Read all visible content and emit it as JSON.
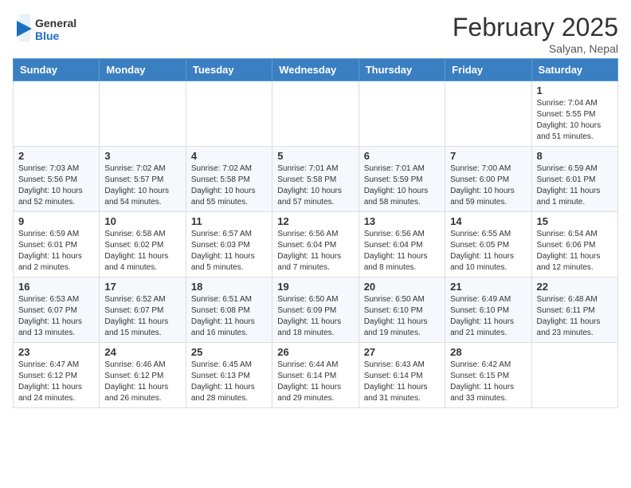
{
  "header": {
    "logo_general": "General",
    "logo_blue": "Blue",
    "month_title": "February 2025",
    "subtitle": "Salyan, Nepal"
  },
  "weekdays": [
    "Sunday",
    "Monday",
    "Tuesday",
    "Wednesday",
    "Thursday",
    "Friday",
    "Saturday"
  ],
  "weeks": [
    [
      {
        "day": "",
        "info": ""
      },
      {
        "day": "",
        "info": ""
      },
      {
        "day": "",
        "info": ""
      },
      {
        "day": "",
        "info": ""
      },
      {
        "day": "",
        "info": ""
      },
      {
        "day": "",
        "info": ""
      },
      {
        "day": "1",
        "info": "Sunrise: 7:04 AM\nSunset: 5:55 PM\nDaylight: 10 hours\nand 51 minutes."
      }
    ],
    [
      {
        "day": "2",
        "info": "Sunrise: 7:03 AM\nSunset: 5:56 PM\nDaylight: 10 hours\nand 52 minutes."
      },
      {
        "day": "3",
        "info": "Sunrise: 7:02 AM\nSunset: 5:57 PM\nDaylight: 10 hours\nand 54 minutes."
      },
      {
        "day": "4",
        "info": "Sunrise: 7:02 AM\nSunset: 5:58 PM\nDaylight: 10 hours\nand 55 minutes."
      },
      {
        "day": "5",
        "info": "Sunrise: 7:01 AM\nSunset: 5:58 PM\nDaylight: 10 hours\nand 57 minutes."
      },
      {
        "day": "6",
        "info": "Sunrise: 7:01 AM\nSunset: 5:59 PM\nDaylight: 10 hours\nand 58 minutes."
      },
      {
        "day": "7",
        "info": "Sunrise: 7:00 AM\nSunset: 6:00 PM\nDaylight: 10 hours\nand 59 minutes."
      },
      {
        "day": "8",
        "info": "Sunrise: 6:59 AM\nSunset: 6:01 PM\nDaylight: 11 hours\nand 1 minute."
      }
    ],
    [
      {
        "day": "9",
        "info": "Sunrise: 6:59 AM\nSunset: 6:01 PM\nDaylight: 11 hours\nand 2 minutes."
      },
      {
        "day": "10",
        "info": "Sunrise: 6:58 AM\nSunset: 6:02 PM\nDaylight: 11 hours\nand 4 minutes."
      },
      {
        "day": "11",
        "info": "Sunrise: 6:57 AM\nSunset: 6:03 PM\nDaylight: 11 hours\nand 5 minutes."
      },
      {
        "day": "12",
        "info": "Sunrise: 6:56 AM\nSunset: 6:04 PM\nDaylight: 11 hours\nand 7 minutes."
      },
      {
        "day": "13",
        "info": "Sunrise: 6:56 AM\nSunset: 6:04 PM\nDaylight: 11 hours\nand 8 minutes."
      },
      {
        "day": "14",
        "info": "Sunrise: 6:55 AM\nSunset: 6:05 PM\nDaylight: 11 hours\nand 10 minutes."
      },
      {
        "day": "15",
        "info": "Sunrise: 6:54 AM\nSunset: 6:06 PM\nDaylight: 11 hours\nand 12 minutes."
      }
    ],
    [
      {
        "day": "16",
        "info": "Sunrise: 6:53 AM\nSunset: 6:07 PM\nDaylight: 11 hours\nand 13 minutes."
      },
      {
        "day": "17",
        "info": "Sunrise: 6:52 AM\nSunset: 6:07 PM\nDaylight: 11 hours\nand 15 minutes."
      },
      {
        "day": "18",
        "info": "Sunrise: 6:51 AM\nSunset: 6:08 PM\nDaylight: 11 hours\nand 16 minutes."
      },
      {
        "day": "19",
        "info": "Sunrise: 6:50 AM\nSunset: 6:09 PM\nDaylight: 11 hours\nand 18 minutes."
      },
      {
        "day": "20",
        "info": "Sunrise: 6:50 AM\nSunset: 6:10 PM\nDaylight: 11 hours\nand 19 minutes."
      },
      {
        "day": "21",
        "info": "Sunrise: 6:49 AM\nSunset: 6:10 PM\nDaylight: 11 hours\nand 21 minutes."
      },
      {
        "day": "22",
        "info": "Sunrise: 6:48 AM\nSunset: 6:11 PM\nDaylight: 11 hours\nand 23 minutes."
      }
    ],
    [
      {
        "day": "23",
        "info": "Sunrise: 6:47 AM\nSunset: 6:12 PM\nDaylight: 11 hours\nand 24 minutes."
      },
      {
        "day": "24",
        "info": "Sunrise: 6:46 AM\nSunset: 6:12 PM\nDaylight: 11 hours\nand 26 minutes."
      },
      {
        "day": "25",
        "info": "Sunrise: 6:45 AM\nSunset: 6:13 PM\nDaylight: 11 hours\nand 28 minutes."
      },
      {
        "day": "26",
        "info": "Sunrise: 6:44 AM\nSunset: 6:14 PM\nDaylight: 11 hours\nand 29 minutes."
      },
      {
        "day": "27",
        "info": "Sunrise: 6:43 AM\nSunset: 6:14 PM\nDaylight: 11 hours\nand 31 minutes."
      },
      {
        "day": "28",
        "info": "Sunrise: 6:42 AM\nSunset: 6:15 PM\nDaylight: 11 hours\nand 33 minutes."
      },
      {
        "day": "",
        "info": ""
      }
    ]
  ]
}
